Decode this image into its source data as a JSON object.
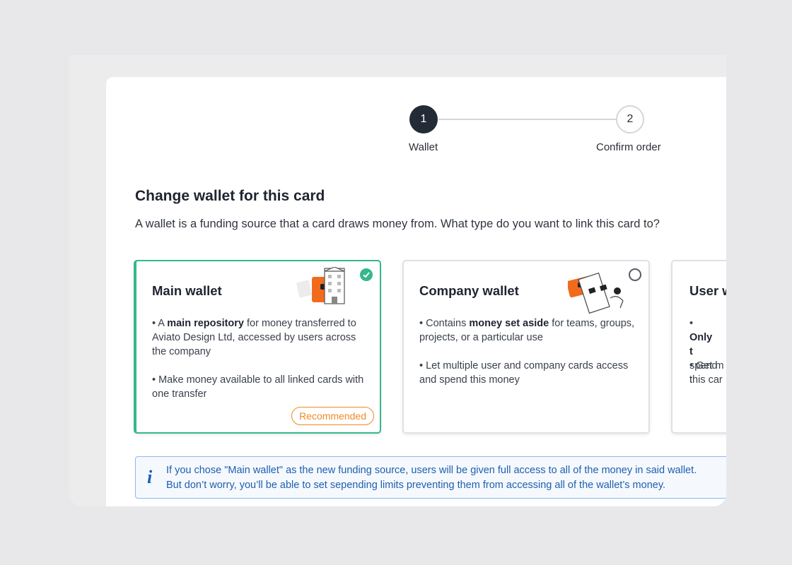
{
  "stepper": {
    "steps": [
      {
        "number": "1",
        "label": "Wallet",
        "active": true
      },
      {
        "number": "2",
        "label": "Confirm order",
        "active": false
      }
    ]
  },
  "header": {
    "title": "Change wallet for this card",
    "subtitle": "A wallet is a funding source that a card draws money from. What type do you want to link this card to?"
  },
  "cards": [
    {
      "title": "Main wallet",
      "selected": true,
      "bullet1_pre": "• A ",
      "bullet1_bold": "main repository",
      "bullet1_post": " for money transferred to Aviato Design Ltd, accessed by users across the company",
      "bullet2": "• Make money available to all linked cards with one transfer",
      "badge": "Recommended",
      "icon": "wallet-building-icon"
    },
    {
      "title": "Company wallet",
      "selected": false,
      "bullet1_pre": "• Contains ",
      "bullet1_bold": "money set aside",
      "bullet1_post": " for teams, groups, projects, or a particular use",
      "bullet2": "• Let multiple user and company cards access and spend this money",
      "icon": "wallet-cards-icon"
    },
    {
      "title": "User w",
      "selected": false,
      "bullet1_pre": "• ",
      "bullet1_bold": "Only t",
      "bullet1_post": " spend t",
      "bullet2": "• Get m this car"
    }
  ],
  "info": {
    "icon": "info-icon",
    "line1": "If you chose \"Main wallet\" as the new funding source, users will be given full access to all of the money in said wallet.",
    "line2": "But don’t worry, you’ll be able to set sepending limits preventing them from accessing all of the wallet’s money."
  },
  "colors": {
    "accent_green": "#34b88c",
    "accent_orange": "#f08a24",
    "info_blue": "#1e5fae",
    "step_active": "#232b36"
  }
}
